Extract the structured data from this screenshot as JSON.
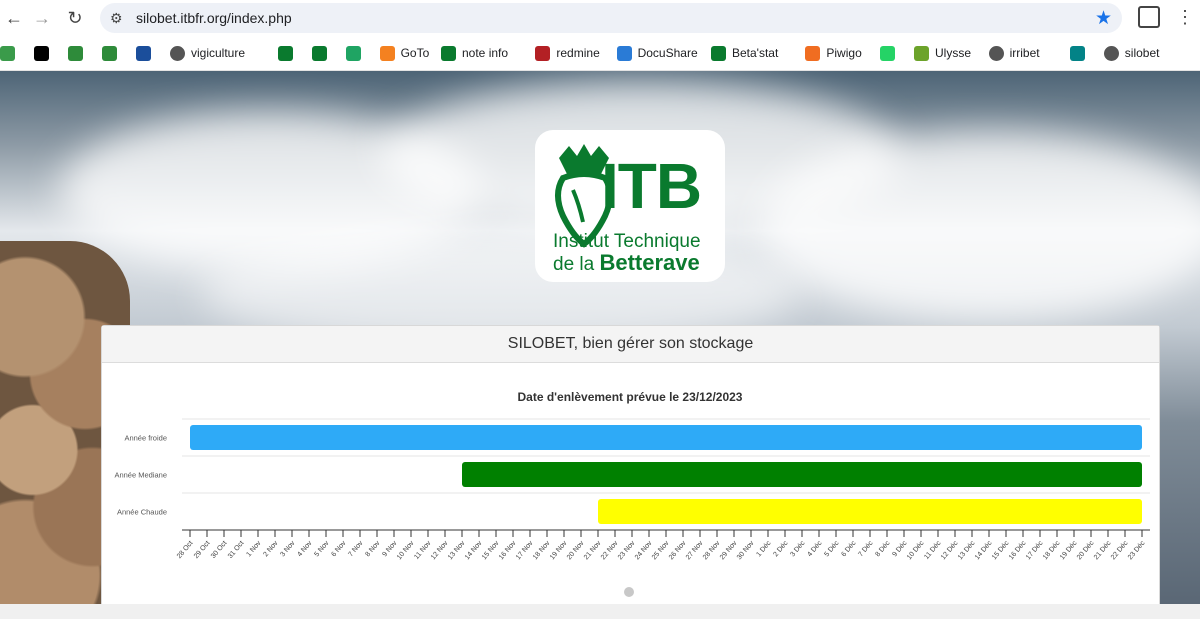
{
  "browser": {
    "url": "silobet.itbfr.org/index.php",
    "back_glyph": "←",
    "forward_glyph": "→",
    "reload_glyph": "↻",
    "star_glyph": "★",
    "tune_glyph": "⚙",
    "menu_glyph": "⋮"
  },
  "bookmarks": [
    {
      "label": "",
      "icon": "leaf-icon",
      "color": "#3a9b4a"
    },
    {
      "label": "",
      "icon": "x-icon",
      "color": "#000000"
    },
    {
      "label": "",
      "icon": "app-icon",
      "color": "#2e8b3a"
    },
    {
      "label": "",
      "icon": "sprout-icon",
      "color": "#2e8b3a"
    },
    {
      "label": "",
      "icon": "eye-icon",
      "color": "#1b4e9b"
    },
    {
      "label": "vigiculture",
      "icon": "globe-icon",
      "color": "#555555"
    },
    {
      "label": "",
      "icon": "beet-icon",
      "color": "#0a7a2e"
    },
    {
      "label": "",
      "icon": "beet-icon",
      "color": "#0a7a2e"
    },
    {
      "label": "",
      "icon": "drive-icon",
      "color": "#1fa463"
    },
    {
      "label": "GoTo",
      "icon": "goto-icon",
      "color": "#f48120"
    },
    {
      "label": "note info",
      "icon": "beet-icon",
      "color": "#0a7a2e"
    },
    {
      "label": "redmine",
      "icon": "redmine-icon",
      "color": "#b32024"
    },
    {
      "label": "DocuShare",
      "icon": "docushare-icon",
      "color": "#2a7bd6"
    },
    {
      "label": "Beta'stat",
      "icon": "itb-icon",
      "color": "#0a7a2e"
    },
    {
      "label": "Piwigo",
      "icon": "piwigo-icon",
      "color": "#f06d21"
    },
    {
      "label": "",
      "icon": "whatsapp-icon",
      "color": "#25d366"
    },
    {
      "label": "Ulysse",
      "icon": "ulysse-icon",
      "color": "#6ca32a"
    },
    {
      "label": "irribet",
      "icon": "globe-icon",
      "color": "#555555"
    },
    {
      "label": "",
      "icon": "sharepoint-icon",
      "color": "#038387"
    },
    {
      "label": "silobet",
      "icon": "globe-icon",
      "color": "#555555"
    }
  ],
  "logo": {
    "mark": "ITB",
    "line1": "Institut Technique",
    "line2_prefix": "de la ",
    "line2_bold": "Betterave",
    "color": "#0a7a2e"
  },
  "panel": {
    "title": "SILOBET, bien gérer son stockage"
  },
  "chart_data": {
    "type": "bar",
    "orientation": "horizontal",
    "title": "Date d'enlèvement prévue le 23/12/2023",
    "categories": [
      "Année froide",
      "Année Mediane",
      "Année Chaude"
    ],
    "x_ticks": [
      "28 Oct",
      "29 Oct",
      "30 Oct",
      "31 Oct",
      "1 Nov",
      "2 Nov",
      "3 Nov",
      "4 Nov",
      "5 Nov",
      "6 Nov",
      "7 Nov",
      "8 Nov",
      "9 Nov",
      "10 Nov",
      "11 Nov",
      "12 Nov",
      "13 Nov",
      "14 Nov",
      "15 Nov",
      "16 Nov",
      "17 Nov",
      "18 Nov",
      "19 Nov",
      "20 Nov",
      "21 Nov",
      "22 Nov",
      "23 Nov",
      "24 Nov",
      "25 Nov",
      "26 Nov",
      "27 Nov",
      "28 Nov",
      "29 Nov",
      "30 Nov",
      "1 Déc",
      "2 Déc",
      "3 Déc",
      "4 Déc",
      "5 Déc",
      "6 Déc",
      "7 Déc",
      "8 Déc",
      "9 Déc",
      "10 Déc",
      "11 Déc",
      "12 Déc",
      "13 Déc",
      "14 Déc",
      "15 Déc",
      "16 Déc",
      "17 Déc",
      "18 Déc",
      "19 Déc",
      "20 Déc",
      "21 Déc",
      "22 Déc",
      "23 Déc"
    ],
    "series": [
      {
        "category": "Année froide",
        "start": "28 Oct",
        "end": "23 Déc",
        "color": "#2eaaf7"
      },
      {
        "category": "Année Mediane",
        "start": "13 Nov",
        "end": "23 Déc",
        "color": "#008000"
      },
      {
        "category": "Année Chaude",
        "start": "21 Nov",
        "end": "23 Déc",
        "color": "#ffff00"
      }
    ]
  }
}
